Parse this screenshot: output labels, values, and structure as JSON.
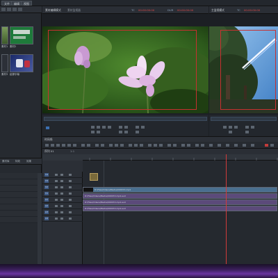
{
  "menubar": {
    "items": [
      {
        "label": "文件"
      },
      {
        "label": "编辑"
      },
      {
        "label": "视图"
      }
    ]
  },
  "source_panel": {
    "title": "素材编辑模式",
    "title2": "素材监视器",
    "tc_label": "TC",
    "tc_value": "00:00:00:00",
    "tc_label2": "DUR",
    "tc_value2": "00:00:00:00"
  },
  "record_panel": {
    "title": "主监视模式",
    "tc_label": "TC",
    "tc_value": "00:00:00:00"
  },
  "bin": {
    "thumbs": [
      {
        "label": "素材1"
      },
      {
        "label": "素材2"
      },
      {
        "label": "素材3"
      },
      {
        "label": "起源字幕"
      }
    ]
  },
  "panel_tabs": [
    {
      "label": "素材库"
    },
    {
      "label": "特效"
    },
    {
      "label": "效果"
    }
  ],
  "timeline": {
    "header_label": "时间线",
    "sub_label": "序列 01",
    "zoom_value": "1:1",
    "tracks": [
      {
        "name": "V4"
      },
      {
        "name": "V3"
      },
      {
        "name": "V2"
      },
      {
        "name": "V1"
      },
      {
        "name": "A1"
      },
      {
        "name": "A2"
      },
      {
        "name": "A3"
      },
      {
        "name": "A4"
      }
    ],
    "clips": [
      {
        "label": "D:\\Files\\Videos\\Media\\000153.mp4",
        "color": "#4a6f8f"
      },
      {
        "label": "D:\\Files\\Videos\\Media\\000153.mp4.aud",
        "color": "#5b4a7a"
      },
      {
        "label": "D:\\Files\\Videos\\Media\\000153.mp4.aud",
        "color": "#5b4a7a"
      },
      {
        "label": "D:\\Files\\Videos\\Media\\000153.mp4.aud",
        "color": "#5b4a7a"
      }
    ]
  },
  "colors": {
    "accent_red": "#e04848",
    "video_clip": "#4a6f8f",
    "audio_clip": "#5b4a7a",
    "track_blue": "#3d5a86"
  }
}
